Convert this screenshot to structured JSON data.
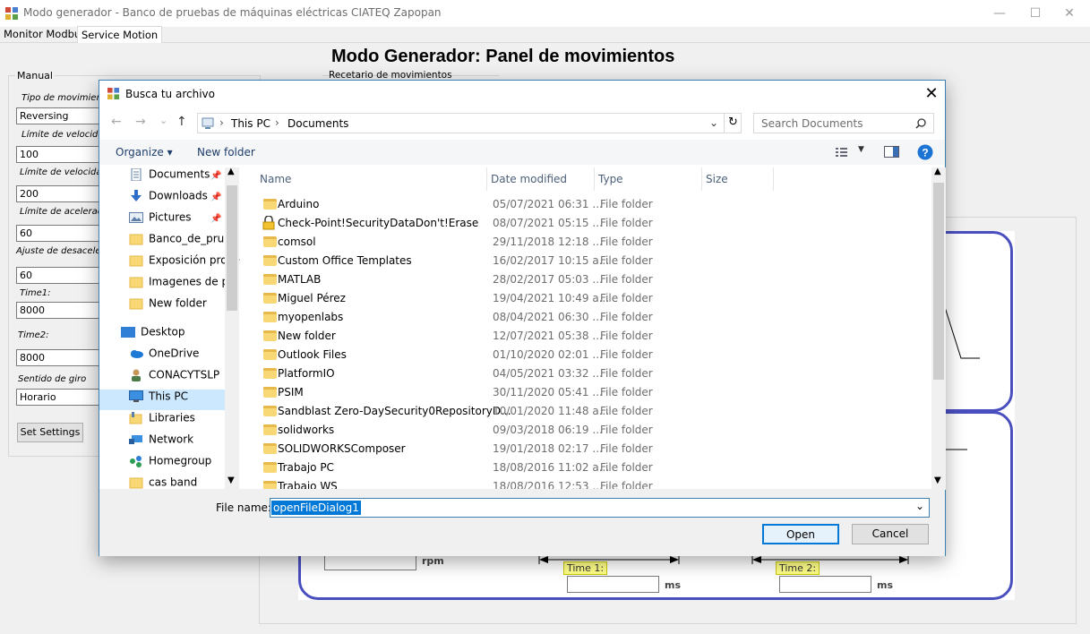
{
  "window": {
    "title": "Modo generador - Banco de pruebas de máquinas eléctricas CIATEQ Zapopan",
    "controls": {
      "minimize": "—",
      "maximize": "☐",
      "close": "✕"
    }
  },
  "tabs": [
    "Monitor Modbus",
    "Service Motion"
  ],
  "panel_title": "Modo Generador: Panel de movimientos",
  "manual": {
    "legend": "Manual",
    "fields": [
      {
        "label": "Tipo de movimiento",
        "value": "Reversing"
      },
      {
        "label": "Límite de velocidad",
        "value": "100"
      },
      {
        "label": "Límite de velocidad",
        "value": "200"
      },
      {
        "label": "Límite de aceleración",
        "value": "60"
      },
      {
        "label": "Ajuste de desaceleración",
        "value": "60"
      },
      {
        "label": "Time1:",
        "value": "8000"
      },
      {
        "label": "Time2:",
        "value": "8000"
      },
      {
        "label": "Sentido de giro",
        "value": "Horario"
      }
    ],
    "button": "Set Settings"
  },
  "recetario_legend": "Recetario de movimientos",
  "diagram": {
    "rpm_unit": "rpm",
    "time1_label": "Time 1:",
    "time2_label": "Time 2:",
    "ms_unit": "ms"
  },
  "dialog": {
    "title": "Busca tu archivo",
    "close": "✕",
    "nav": {
      "back": "←",
      "forward": "→",
      "recent": "⌄",
      "up": "↑"
    },
    "breadcrumb": [
      "This PC",
      "Documents"
    ],
    "search_placeholder": "Search Documents",
    "organize": "Organize ▾",
    "new_folder": "New folder",
    "nav_pane": [
      {
        "label": "Documents",
        "icon": "documents-icon",
        "pinned": true
      },
      {
        "label": "Downloads",
        "icon": "downloads-icon",
        "pinned": true
      },
      {
        "label": "Pictures",
        "icon": "pictures-icon",
        "pinned": true
      },
      {
        "label": "Banco_de_prueb",
        "icon": "folder-icon",
        "pinned": false
      },
      {
        "label": "Exposición proye",
        "icon": "folder-icon",
        "pinned": false
      },
      {
        "label": "Imagenes de pro",
        "icon": "folder-icon",
        "pinned": false
      },
      {
        "label": "New folder",
        "icon": "folder-icon",
        "pinned": false
      },
      {
        "label": "Desktop",
        "icon": "desktop-icon",
        "pinned": false
      },
      {
        "label": "OneDrive",
        "icon": "onedrive-icon",
        "pinned": false
      },
      {
        "label": "CONACYTSLP",
        "icon": "user-icon",
        "pinned": false
      },
      {
        "label": "This PC",
        "icon": "pc-icon",
        "pinned": false,
        "selected": true
      },
      {
        "label": "Libraries",
        "icon": "libraries-icon",
        "pinned": false
      },
      {
        "label": "Network",
        "icon": "network-icon",
        "pinned": false
      },
      {
        "label": "Homegroup",
        "icon": "homegroup-icon",
        "pinned": false
      },
      {
        "label": "cas band",
        "icon": "folder-icon",
        "pinned": false
      }
    ],
    "columns": [
      "Name",
      "Date modified",
      "Type",
      "Size"
    ],
    "files": [
      {
        "name": "Arduino",
        "date": "05/07/2021 06:31 ...",
        "type": "File folder"
      },
      {
        "name": "Check-Point!SecurityDataDon't!Erase",
        "date": "08/07/2021 05:15 ...",
        "type": "File folder",
        "locked": true
      },
      {
        "name": "comsol",
        "date": "29/11/2018 12:18 ...",
        "type": "File folder"
      },
      {
        "name": "Custom Office Templates",
        "date": "16/02/2017 10:15 a...",
        "type": "File folder"
      },
      {
        "name": "MATLAB",
        "date": "28/02/2017 05:03 ...",
        "type": "File folder"
      },
      {
        "name": "Miguel Pérez",
        "date": "19/04/2021 10:49 a...",
        "type": "File folder"
      },
      {
        "name": "myopenlabs",
        "date": "08/04/2021 06:30 ...",
        "type": "File folder"
      },
      {
        "name": "New folder",
        "date": "12/07/2021 05:38 ...",
        "type": "File folder"
      },
      {
        "name": "Outlook Files",
        "date": "01/10/2020 02:01 ...",
        "type": "File folder"
      },
      {
        "name": "PlatformIO",
        "date": "04/05/2021 03:32 ...",
        "type": "File folder"
      },
      {
        "name": "PSIM",
        "date": "30/11/2020 05:41 ...",
        "type": "File folder"
      },
      {
        "name": "Sandblast Zero-DaySecurity0RepositoryD...",
        "date": "10/01/2020 11:48 a...",
        "type": "File folder"
      },
      {
        "name": "solidworks",
        "date": "09/03/2018 06:19 ...",
        "type": "File folder"
      },
      {
        "name": "SOLIDWORKSComposer",
        "date": "19/01/2018 02:17 ...",
        "type": "File folder"
      },
      {
        "name": "Trabajo PC",
        "date": "18/08/2016 11:02 a...",
        "type": "File folder"
      },
      {
        "name": "Trabajo WS",
        "date": "18/08/2016 12:53 ...",
        "type": "File folder"
      }
    ],
    "file_name_label": "File name:",
    "file_name_value": "openFileDialog1",
    "open": "Open",
    "cancel": "Cancel"
  }
}
